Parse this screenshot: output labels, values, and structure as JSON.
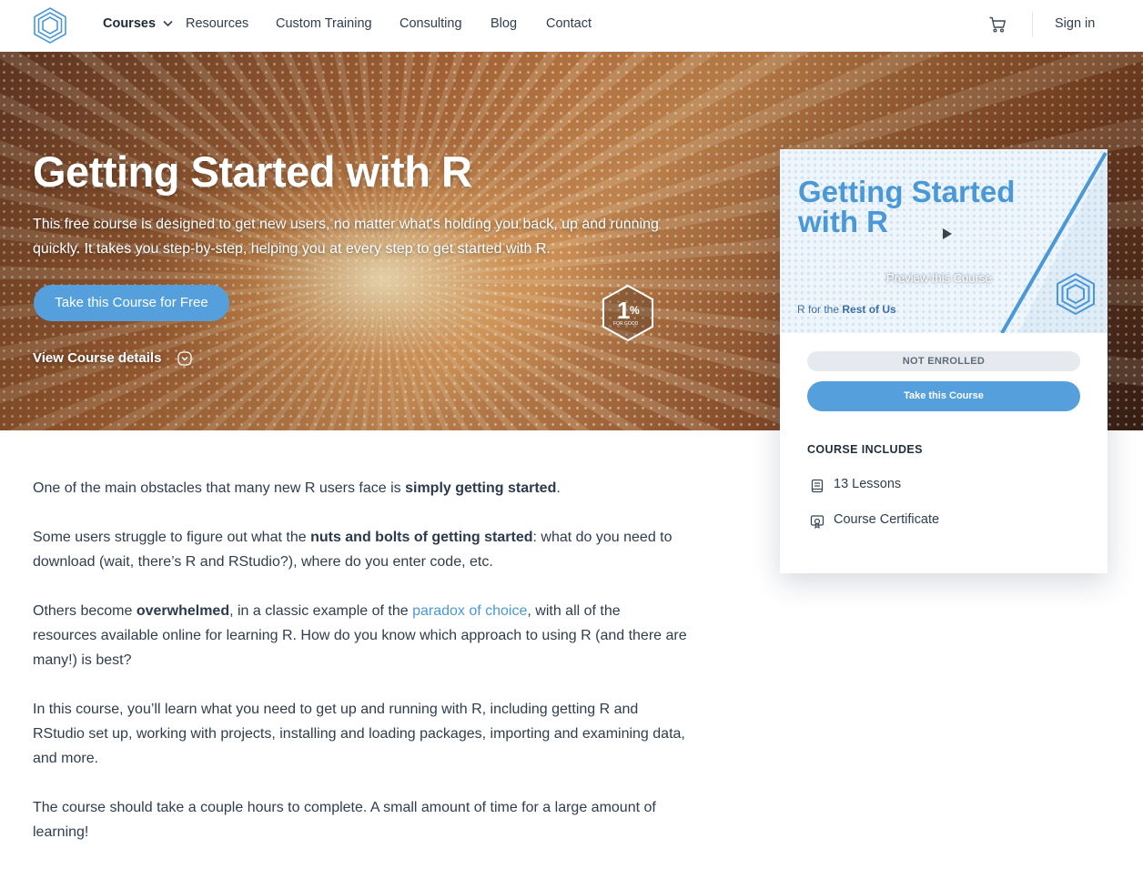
{
  "nav": {
    "items": [
      {
        "label": "Courses"
      },
      {
        "label": "Resources"
      },
      {
        "label": "Custom Training"
      },
      {
        "label": "Consulting"
      },
      {
        "label": "Blog"
      },
      {
        "label": "Contact"
      }
    ],
    "signin": "Sign in",
    "icons": {
      "logo": "hexagon-logo",
      "cart": "cart-icon"
    }
  },
  "hero": {
    "title": "Getting Started with R",
    "description": "This free course is designed to get new users, no matter what's holding you back, up and running quickly. It takes you step-by-step, helping you at every step to get started with R.",
    "cta": "Take this Course for Free",
    "details_link": "View Course details",
    "badge": {
      "number": "1",
      "symbol": "%",
      "caption": "FOR GOOD"
    }
  },
  "card": {
    "preview_title": "Getting Started with R",
    "preview_label": "Preview this Course",
    "brand_prefix": "R for the",
    "brand_suffix": "Rest of Us",
    "status": "NOT ENROLLED",
    "take_button": "Take this Course",
    "includes_heading": "COURSE INCLUDES",
    "includes": [
      {
        "icon": "book-icon",
        "label": "13 Lessons"
      },
      {
        "icon": "certificate-icon",
        "label": "Course Certificate"
      }
    ]
  },
  "content": {
    "p1": {
      "a": "One of the main obstacles that many new R users face is ",
      "b": "simply getting started",
      "c": "."
    },
    "p2": {
      "a": "Some users struggle to figure out what the ",
      "b": "nuts and bolts of getting started",
      "c": ": what do you need to download (wait, there’s R and RStudio?), where do you enter code, etc."
    },
    "p3": {
      "a": "Others become ",
      "b": "overwhelmed",
      "c": ", in a classic example of the ",
      "link": "paradox of choice",
      "d": ", with all of the resources available online for learning R. How do you know which approach to using R (and there are many!) is best?"
    },
    "p4": "In this course, you’ll learn what you need to get up and running with R, including getting R and RStudio set up, working with projects, installing and loading packages, importing and examining data, and more.",
    "p5": "The course should take a couple hours to complete. A small amount of time for a large amount of learning!"
  },
  "colors": {
    "accent": "#55a0dc",
    "text": "#2f3d4e",
    "link": "#4a98d6",
    "pill": "#e6e9ee"
  }
}
